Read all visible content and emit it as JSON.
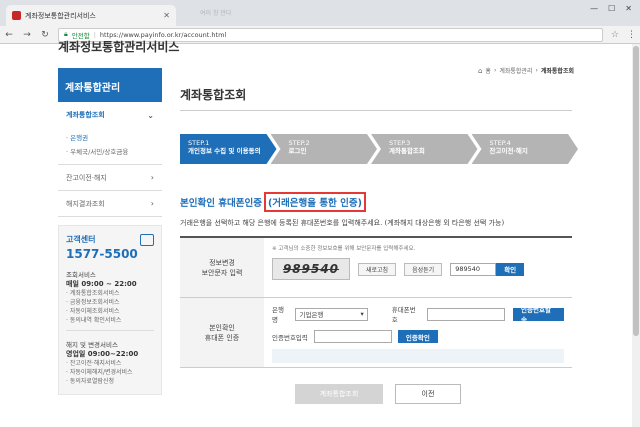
{
  "browser": {
    "tab_title": "계좌정보통합관리서비스",
    "ghost_tabs": "여러 창 만다",
    "secure_label": "안전함",
    "url": "https://www.payinfo.or.kr/account.html"
  },
  "site": {
    "logo": "계좌정보통합관리서비스"
  },
  "sidebar": {
    "header": "계좌통합관리",
    "menu_account": "계좌통합조회",
    "sub_items": [
      "은행권",
      "우체국/서민/상호금융"
    ],
    "menu_transfer": "잔고이전·해지",
    "menu_result": "해지결과조회",
    "cs": {
      "title": "고객센터",
      "phone": "1577-5500",
      "inquiry_label": "조회서비스",
      "inquiry_hours": "매일 09:00 ~ 22:00",
      "inquiry_lines": [
        "계좌통합조회서비스",
        "금융정보조회서비스",
        "자동이체조회서비스",
        "동의내역 확인서비스"
      ],
      "change_label": "해지 및 변경서비스",
      "change_hours": "영업일 09:00~22:00",
      "change_lines": [
        "잔고이전·해지서비스",
        "자동이체해지/변경서비스",
        "동의자료열람신청"
      ]
    }
  },
  "breadcrumb": {
    "home": "홈",
    "level1": "계좌통합관리",
    "level2": "계좌통합조회"
  },
  "main": {
    "title": "계좌통합조회",
    "steps": [
      {
        "num": "STEP.1",
        "name": "개인정보 수집 및 이용동의"
      },
      {
        "num": "STEP.2",
        "name": "로그인"
      },
      {
        "num": "STEP.3",
        "name": "계좌통합조회"
      },
      {
        "num": "STEP.4",
        "name": "잔고이전·해지"
      }
    ],
    "section_title": "본인확인 휴대폰인증",
    "section_highlight": "(거래은행을 통한 인증)",
    "section_desc": "거래은행을 선택하고 해당 은행에 등록된 휴대폰번호를 입력해주세요. (계좌해지 대상은행 외 타은행 선택 가능)"
  },
  "form": {
    "captcha_label": "정보변경\n보안문자 입력",
    "captcha_note": "※ 고객님의 소중한 정보보호를 위해 보안문자를 입력해주세요.",
    "captcha_text": "989540",
    "refresh_label": "새로고침",
    "audio_label": "음성듣기",
    "captcha_input": "989540",
    "confirm_label": "확인",
    "auth_label": "본인확인\n휴대폰 인증",
    "bank_label": "은행명",
    "bank_value": "기업은행",
    "phone_label": "휴대폰번호",
    "send_code_label": "인증번호발송",
    "code_label": "인증번호입력",
    "verify_label": "인증확인"
  },
  "actions": {
    "submit": "계좌통합조회",
    "prev": "이전"
  }
}
